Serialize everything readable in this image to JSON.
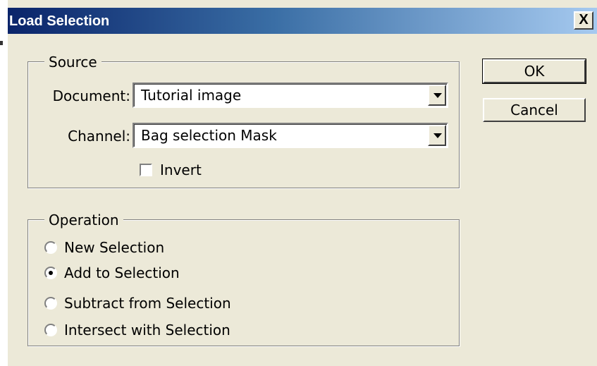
{
  "window": {
    "title": "Load Selection",
    "close_glyph": "X"
  },
  "source": {
    "legend": "Source",
    "document_label": "Document:",
    "document_value": "Tutorial image",
    "channel_label": "Channel:",
    "channel_value": "Bag selection Mask",
    "invert_label": "Invert",
    "invert_checked": false
  },
  "operation": {
    "legend": "Operation",
    "options": [
      {
        "label": "New Selection",
        "selected": false
      },
      {
        "label": "Add to Selection",
        "selected": true
      },
      {
        "label": "Subtract from Selection",
        "selected": false
      },
      {
        "label": "Intersect with Selection",
        "selected": false
      }
    ]
  },
  "buttons": {
    "ok": "OK",
    "cancel": "Cancel"
  },
  "colors": {
    "face": "#ece9d8",
    "title_start": "#0a246a",
    "title_end": "#a6caf0"
  },
  "icons": {
    "combo_arrow": "chevron-down-icon",
    "close": "close-icon"
  }
}
